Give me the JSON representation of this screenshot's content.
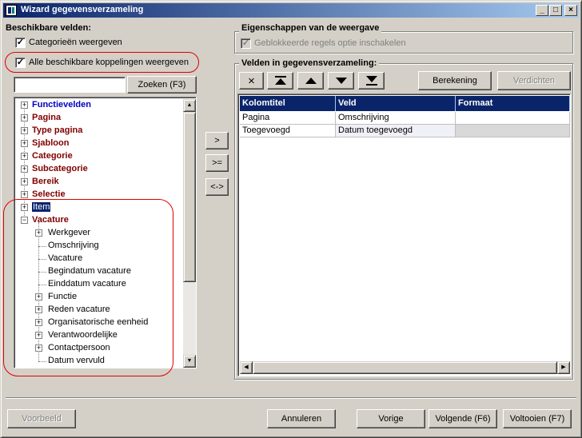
{
  "window": {
    "title": "Wizard gegevensverzameling",
    "controls": {
      "minimize": "_",
      "maximize": "□",
      "close": "×"
    }
  },
  "left": {
    "group_label": "Beschikbare velden:",
    "option_categories": {
      "label": "Categorieën weergeven",
      "checked": true
    },
    "option_all_links": {
      "label": "Alle beschikbare koppelingen weergeven",
      "checked": true
    },
    "search": {
      "value": "",
      "button": "Zoeken (F3)"
    },
    "tree": [
      {
        "label": "Functievelden",
        "style": "blue",
        "expander": "+",
        "level": 0
      },
      {
        "label": "Pagina",
        "style": "cat",
        "expander": "+",
        "level": 0
      },
      {
        "label": "Type pagina",
        "style": "cat",
        "expander": "+",
        "level": 0
      },
      {
        "label": "Sjabloon",
        "style": "cat",
        "expander": "+",
        "level": 0
      },
      {
        "label": "Categorie",
        "style": "cat",
        "expander": "+",
        "level": 0
      },
      {
        "label": "Subcategorie",
        "style": "cat",
        "expander": "+",
        "level": 0
      },
      {
        "label": "Bereik",
        "style": "cat",
        "expander": "+",
        "level": 0
      },
      {
        "label": "Selectie",
        "style": "cat",
        "expander": "+",
        "level": 0
      },
      {
        "label": "Item",
        "style": "sel",
        "expander": "+",
        "level": 0
      },
      {
        "label": "Vacature",
        "style": "cat",
        "expander": "−",
        "level": 0
      },
      {
        "label": "Werkgever",
        "style": "normal",
        "expander": "+",
        "level": 1
      },
      {
        "label": "Omschrijving",
        "style": "normal",
        "expander": "",
        "level": 1
      },
      {
        "label": "Vacature",
        "style": "normal",
        "expander": "",
        "level": 1
      },
      {
        "label": "Begindatum vacature",
        "style": "normal",
        "expander": "",
        "level": 1
      },
      {
        "label": "Einddatum vacature",
        "style": "normal",
        "expander": "",
        "level": 1
      },
      {
        "label": "Functie",
        "style": "normal",
        "expander": "+",
        "level": 1
      },
      {
        "label": "Reden vacature",
        "style": "normal",
        "expander": "+",
        "level": 1
      },
      {
        "label": "Organisatorische eenheid",
        "style": "normal",
        "expander": "+",
        "level": 1
      },
      {
        "label": "Verantwoordelijke",
        "style": "normal",
        "expander": "+",
        "level": 1
      },
      {
        "label": "Contactpersoon",
        "style": "normal",
        "expander": "+",
        "level": 1
      },
      {
        "label": "Datum vervuld",
        "style": "normal",
        "expander": "",
        "level": 1
      }
    ]
  },
  "middle_buttons": {
    "add": ">",
    "add_all": ">=",
    "swap": "<->"
  },
  "right": {
    "props_label": "Eigenschappen van de weergave",
    "option_blocked": {
      "label": "Geblokkeerde regels optie inschakelen",
      "checked": true,
      "disabled": true
    },
    "fields_label": "Velden in gegevensverzameling:",
    "toolbar": {
      "remove_icon": "×",
      "berekening": "Berekening",
      "verdichten": "Verdichten"
    },
    "columns": [
      "Kolomtitel",
      "Veld",
      "Formaat"
    ],
    "rows": [
      [
        "Pagina",
        "Omschrijving",
        ""
      ],
      [
        "Toegevoegd",
        "Datum toegevoegd",
        ""
      ]
    ]
  },
  "footer": {
    "voorbeeld": "Voorbeeld",
    "annuleren": "Annuleren",
    "vorige": "Vorige",
    "volgende": "Volgende (F6)",
    "voltooien": "Voltooien (F7)"
  },
  "colors": {
    "titlebar_start": "#0a246a",
    "titlebar_end": "#a6caf0",
    "category_text": "#800000",
    "link_text": "#0000c0",
    "highlight_oval": "#e00000",
    "face": "#d4d0c8"
  }
}
